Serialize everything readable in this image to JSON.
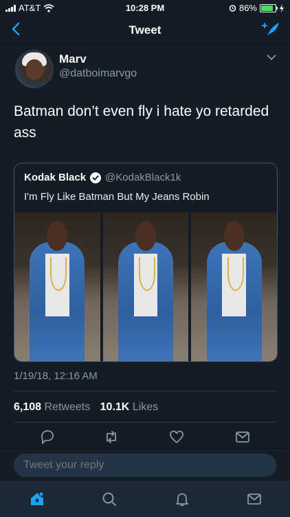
{
  "status_bar": {
    "carrier": "AT&T",
    "time": "10:28 PM",
    "battery": "86%",
    "battery_level": 0.86
  },
  "nav": {
    "title": "Tweet"
  },
  "tweet": {
    "author_name": "Marv",
    "author_handle": "@datboimarvgo",
    "text": "Batman don’t even fly i hate yo retarded ass",
    "timestamp": "1/19/18, 12:16 AM",
    "retweets_count": "6,108",
    "retweets_label": "Retweets",
    "likes_count": "10.1K",
    "likes_label": "Likes"
  },
  "quoted_tweet": {
    "author_name": "Kodak Black",
    "author_handle": "@KodakBlack1k",
    "text": "I'm Fly Like Batman But My Jeans Robin",
    "media_count": 3
  },
  "reply": {
    "placeholder": "Tweet your reply"
  },
  "colors": {
    "background": "#141d26",
    "accent": "#1da1f2",
    "muted": "#8899a6",
    "input_bg": "#243447"
  },
  "icons": {
    "nav": [
      "back-chevron-icon",
      "compose-tweet-icon"
    ],
    "actions": [
      "reply-icon",
      "retweet-icon",
      "like-icon",
      "direct-message-icon"
    ],
    "tabs": [
      "home-icon",
      "search-icon",
      "notifications-icon",
      "messages-icon"
    ]
  }
}
